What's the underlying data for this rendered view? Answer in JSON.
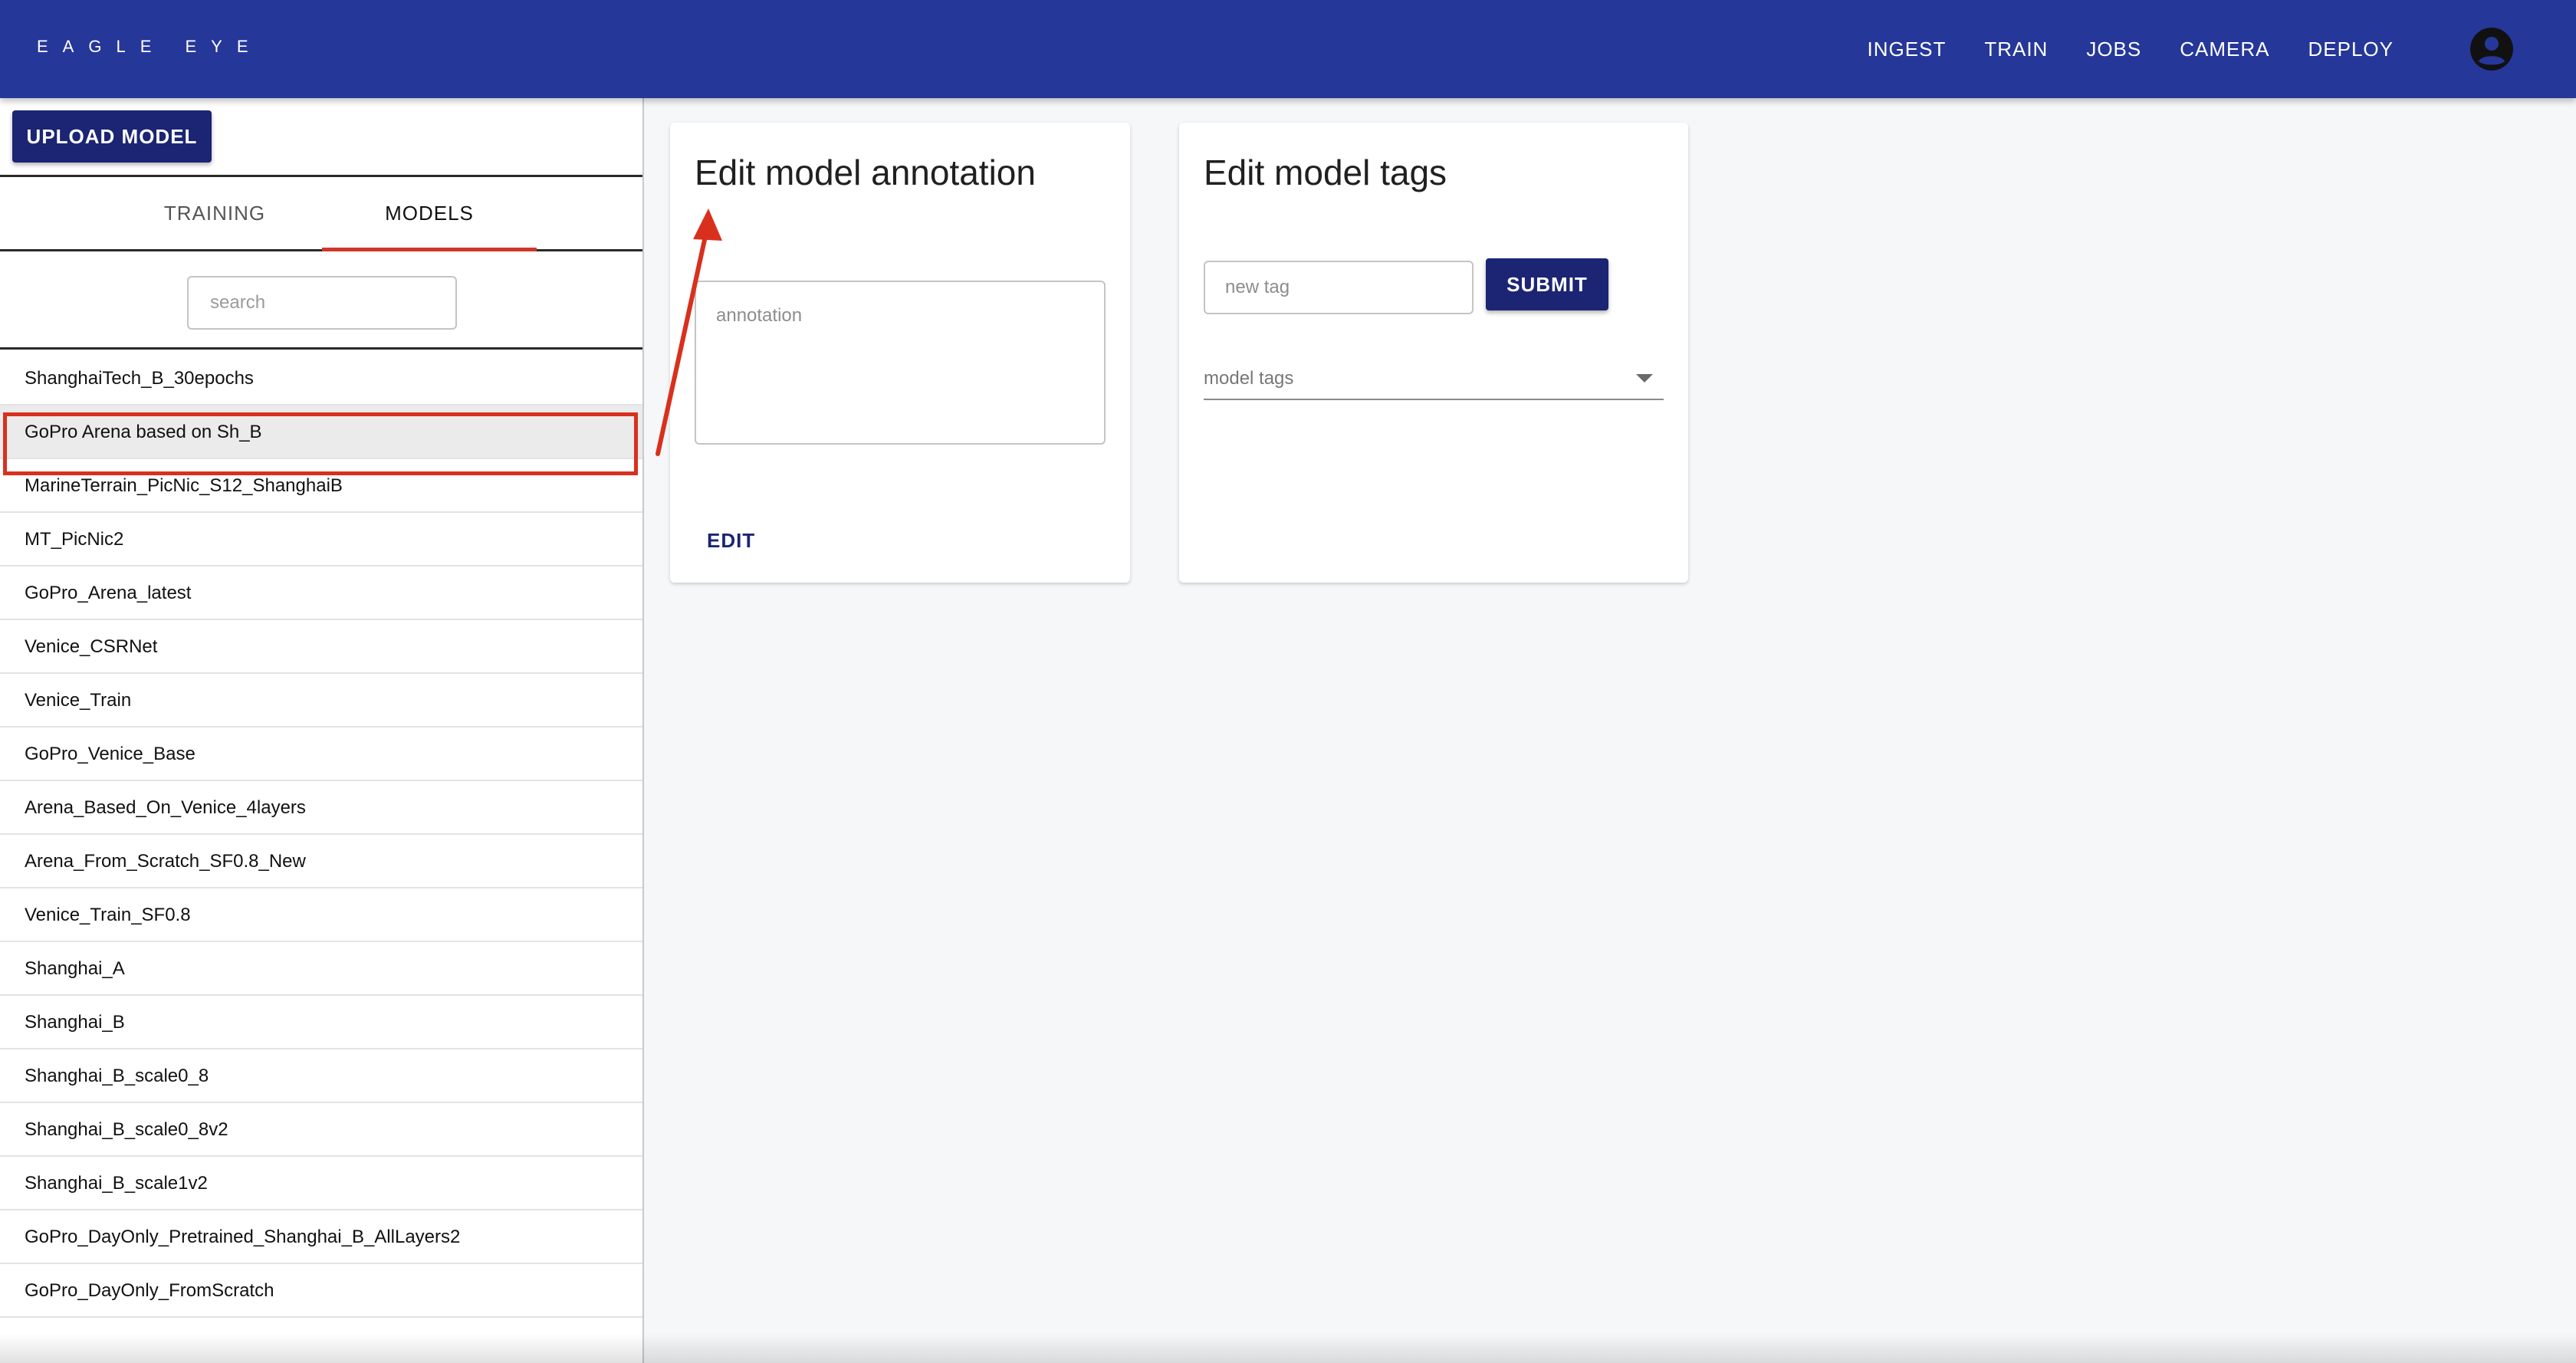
{
  "header": {
    "brand": "EAGLE EYE",
    "nav": [
      "INGEST",
      "TRAIN",
      "JOBS",
      "CAMERA",
      "DEPLOY"
    ],
    "account_icon": "account-circle-icon",
    "color": "#26379a"
  },
  "sidebar": {
    "upload_label": "UPLOAD MODEL",
    "tabs": [
      "TRAINING",
      "MODELS"
    ],
    "active_tab": "MODELS",
    "tab_indicator_color": "#d1352a",
    "search_placeholder": "search",
    "selected_model": "GoPro Arena based on Sh_B",
    "models": [
      "ShanghaiTech_B_30epochs",
      "GoPro Arena based on Sh_B",
      "MarineTerrain_PicNic_S12_ShanghaiB",
      "MT_PicNic2",
      "GoPro_Arena_latest",
      "Venice_CSRNet",
      "Venice_Train",
      "GoPro_Venice_Base",
      "Arena_Based_On_Venice_4layers",
      "Arena_From_Scratch_SF0.8_New",
      "Venice_Train_SF0.8",
      "Shanghai_A",
      "Shanghai_B",
      "Shanghai_B_scale0_8",
      "Shanghai_B_scale0_8v2",
      "Shanghai_B_scale1v2",
      "GoPro_DayOnly_Pretrained_Shanghai_B_AllLayers2",
      "GoPro_DayOnly_FromScratch"
    ]
  },
  "annotation_card": {
    "title": "Edit model annotation",
    "placeholder": "annotation",
    "edit_label": "EDIT"
  },
  "tags_card": {
    "title": "Edit model tags",
    "input_placeholder": "new tag",
    "submit_label": "SUBMIT",
    "select_label": "model tags"
  },
  "annotation_marker_color": "#d9301e",
  "button_color": "#1b2573"
}
